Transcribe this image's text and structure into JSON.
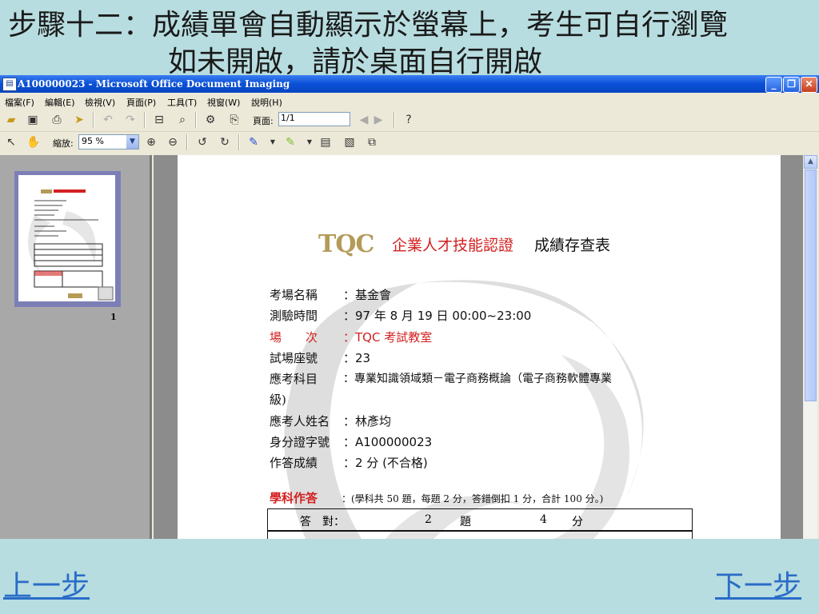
{
  "heading": {
    "line1": "步驟十二：成績單會自動顯示於螢幕上，考生可自行瀏覽",
    "line2": "如未開啟，請於桌面自行開啟"
  },
  "window": {
    "title": "A100000023 - Microsoft Office Document Imaging",
    "controls": {
      "minimize": "_",
      "restore": "❐",
      "close": "✕"
    }
  },
  "menu": [
    "檔案(F)",
    "編輯(E)",
    "檢視(V)",
    "頁面(P)",
    "工具(T)",
    "視窗(W)",
    "說明(H)"
  ],
  "toolbar": {
    "page_label": "頁面:",
    "page_value": "1/1",
    "zoom_label": "縮放:",
    "zoom_value": "95 %"
  },
  "thumbnail": {
    "page_number": "1"
  },
  "document": {
    "logo": "TQC",
    "title_red": "企業人才技能認證",
    "title_black": "成績存查表",
    "fields": [
      {
        "key": "考場名稱",
        "value": "：基金會",
        "red": false
      },
      {
        "key": "測驗時間",
        "value": "：97 年 8 月 19 日  00:00~23:00",
        "red": false
      },
      {
        "key": "場　　次",
        "value": "：TQC 考試教室",
        "red": true
      },
      {
        "key": "試場座號",
        "value": "：23",
        "red": false
      },
      {
        "key": "應考科目",
        "value": "：專業知識領域類－電子商務概論（電子商務軟體專業",
        "red": false
      },
      {
        "key": "級)",
        "value": "",
        "red": false
      },
      {
        "key": "應考人姓名",
        "value": "：林彥均",
        "red": false
      },
      {
        "key": "身分證字號",
        "value": "：A100000023",
        "red": false
      },
      {
        "key": "作答成績",
        "value": "：2  分  (不合格)",
        "red": false
      }
    ],
    "section_label": "學科作答",
    "section_note": "：(學科共 50 題，每題 2 分，答錯倒扣 1 分，合計 100 分。)",
    "score_row": {
      "label": "答　對：",
      "count": "2",
      "unit1": "題",
      "points": "4",
      "unit2": "分"
    }
  },
  "nav": {
    "prev": "上一步",
    "next": "下一步"
  },
  "colors": {
    "accent": "#0a4fd6",
    "background": "#b8dde0",
    "link": "#2a6cc8"
  }
}
